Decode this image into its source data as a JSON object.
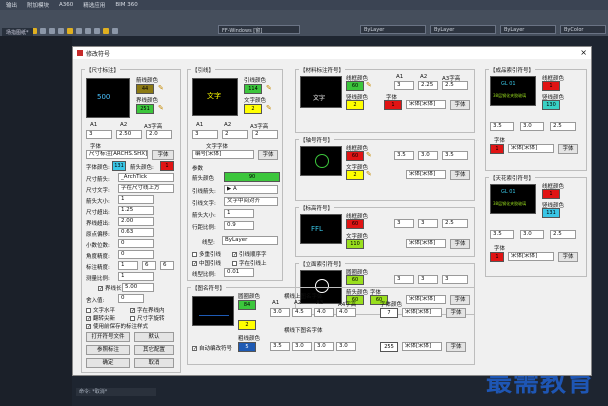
{
  "menubar": {
    "items": [
      "输出",
      "附加模块",
      "A360",
      "精选应用",
      "BIM 360"
    ]
  },
  "ribbon": {
    "file_tab": "场指图纸*",
    "layer_a": "FF-Windows [窗]",
    "bylayer1": "ByLayer",
    "bylayer2": "ByLayer",
    "bylayer3": "ByLayer",
    "bycolor": "ByColor"
  },
  "cmdline": "命令: *取消*",
  "watermark": "最需教育",
  "dialog": {
    "title": "修改符号",
    "dim": {
      "group": "【尺寸标注】",
      "line_color_lbl": "箭线颜色",
      "line_color": "44",
      "ext_color_lbl": "界线颜色",
      "ext_color": "251",
      "h_a1": "A1",
      "h_a2": "A2",
      "h_a3": "A3字高",
      "v_a1": "3",
      "v_a2": "2.50",
      "v_a3": "2.0",
      "font_lbl": "字体",
      "font_val": "尺寸标注[ARCHS.SHX]",
      "font_btn": "字体",
      "txt_color_lbl": "字体颜色:",
      "txt_color": "131",
      "arrow_color_lbl": "箭头颜色:",
      "arrow_color": "1",
      "rows": [
        {
          "label": "尺寸箭头:",
          "value": "_ArchTick"
        },
        {
          "label": "尺寸文字:",
          "value": "字在尺寸线上方"
        },
        {
          "label": "箭头大小:",
          "value": "1"
        },
        {
          "label": "尺寸超出:",
          "value": "1.25"
        },
        {
          "label": "界线超出:",
          "value": "2.00"
        },
        {
          "label": "原点偏移:",
          "value": "0.63"
        },
        {
          "label": "小数位数:",
          "value": "0"
        },
        {
          "label": "角度精度:",
          "value": "0"
        },
        {
          "label": "标注精度:",
          "value": "1"
        },
        {
          "label": "测量比例:",
          "value": "1"
        }
      ],
      "precision_a": "6",
      "precision_b": "6",
      "check_extline": "界线长",
      "extline_val": "5.00",
      "round_lbl": "舍入值:",
      "round_val": "0",
      "checks": [
        "文字水平",
        "字在界线内",
        "翻转尖新",
        "尺寸字旋转",
        "使用前保存的标注样式"
      ],
      "btn_open": "打开符号文件",
      "btn_default": "默认",
      "btn_ref": "参照标注",
      "btn_config": "其它配置",
      "btn_ok": "确定",
      "btn_cancel": "取消"
    },
    "lead": {
      "group": "【引线】",
      "line_color_lbl": "引线颜色",
      "line_color": "114",
      "text_color_lbl": "文字颜色",
      "text_color": "2",
      "preview": "文字",
      "h_a1": "A1",
      "h_a2": "A2",
      "h_a3": "A3字高",
      "v_a1": "3",
      "v_a2": "2",
      "v_a3": "2",
      "font_lbl": "文字字体",
      "font_val": "编号[宋体]",
      "font_btn": "字体",
      "param_lbl": "参数",
      "arrow_color_lbl": "箭头颜色",
      "arrow_color": "90",
      "rows": [
        {
          "label": "引线箭头:",
          "value": "▶ A"
        },
        {
          "label": "引线文字:",
          "value": "文字中间对齐"
        },
        {
          "label": "箭头大小:",
          "value": "1"
        },
        {
          "label": "行距比例:",
          "value": "0.9"
        }
      ],
      "lt_lbl": "线型:",
      "lt_val": "ByLayer",
      "checks": [
        "多重引线",
        "引线顺序字",
        "中国引线",
        "字在引线上"
      ],
      "scale_lbl": "线型比例:",
      "scale_val": "0.01"
    },
    "mat": {
      "group": "【材料标注符号】",
      "line_color_lbl": "线框颜色",
      "line_color": "60",
      "red_lbl": "竖线颜色",
      "red_color": "2",
      "font_color_lbl": "字体",
      "font_color": "1",
      "preview": "文字",
      "h_a1": "A1",
      "h_a2": "A2",
      "h_a3": "A3字高",
      "v_a1": "3",
      "v_a2": "2.25",
      "v_a3": "2.5",
      "font_val": "宋体[宋体]",
      "font_btn": "字体"
    },
    "axis": {
      "group": "【轴号符号】",
      "line_color_lbl": "线框颜色",
      "line_color": "60",
      "txt_color_lbl": "文字颜色",
      "txt_color": "2",
      "v_a1": "3.5",
      "v_a2": "3.0",
      "v_a3": "3.5",
      "font_val": "宋体[宋体]",
      "font_btn": "字体"
    },
    "mark": {
      "group": "【标高符号】",
      "line_color_lbl": "线框颜色",
      "line_color": "60",
      "txt_color_lbl": "文字颜色",
      "txt_color": "110",
      "preview": "FFL",
      "v_a1": "3",
      "v_a2": "3",
      "v_a3": "2.5",
      "font_val": "宋体[宋体]",
      "font_btn": "字体"
    },
    "idx": {
      "group": "【立面索引符号】",
      "line_color_lbl": "圆圈颜色",
      "line_color": "60",
      "dir_lbl": "箭头颜色",
      "dir_color": "60",
      "txt_lbl": "字体",
      "txt_color": "60",
      "v_a1": "3",
      "v_a2": "3",
      "v_a3": "3",
      "font_val": "宋体[宋体]",
      "font_btn": "字体"
    },
    "pic": {
      "group": "【图名符号】",
      "c1_lbl": "圆圈颜色",
      "c1": "84",
      "c2": "2",
      "c3_lbl": "粗线颜色",
      "c3": "5",
      "auto_lbl": "自动编改符号",
      "up_lbl": "横线上图名字体",
      "h_a1": "A1",
      "h_a2": "A2",
      "h_a3": "A3",
      "h_a4": "A4字高",
      "up_vals": [
        "3.0",
        "4.5",
        "4.0",
        "4.0"
      ],
      "up_color_lbl": "字体颜色",
      "up_color": "7",
      "up_font": "宋体[宋体]",
      "up_btn": "字体",
      "dn_lbl": "横线下图名字体",
      "dn_vals": [
        "3.5",
        "3.0",
        "3.0",
        "3.0"
      ],
      "dn_color": "255",
      "dn_font": "宋体[宋体]",
      "dn_btn": "字体"
    },
    "fin": {
      "group": "【成品索引符号】",
      "line_color_lbl": "线框颜色",
      "line_color": "1",
      "dir_lbl": "竖线颜色",
      "dir_color": "130",
      "preview": "GL 01",
      "preview2": "38层钢化夹胶玻璃",
      "v_a1": "3.5",
      "v_a2": "3.0",
      "v_a3": "2.5",
      "font_lbl": "字体",
      "font_color": "1",
      "font_val": "宋体[宋体]",
      "font_btn": "字体"
    },
    "lam": {
      "group": "【天花索引符号】",
      "line_color_lbl": "线框颜色",
      "line_color": "1",
      "dir_lbl": "竖线颜色",
      "dir_color": "131",
      "preview": "GL 01",
      "preview2": "38层钢化夹胶玻璃",
      "v_a1": "3.5",
      "v_a2": "3.0",
      "v_a3": "2.5",
      "font_lbl": "字体",
      "font_color": "1",
      "font_val": "宋体[宋体]",
      "font_btn": "字体"
    }
  },
  "colors": {
    "yellow": "#ffff00",
    "green": "#3cc63c",
    "red": "#e01414",
    "cyan": "#39c6e6",
    "olive": "#8c7a14",
    "blue": "#1e5ab4",
    "teal": "#38d0c4",
    "pink": "#f08aa8",
    "lime": "#9adf1e"
  }
}
